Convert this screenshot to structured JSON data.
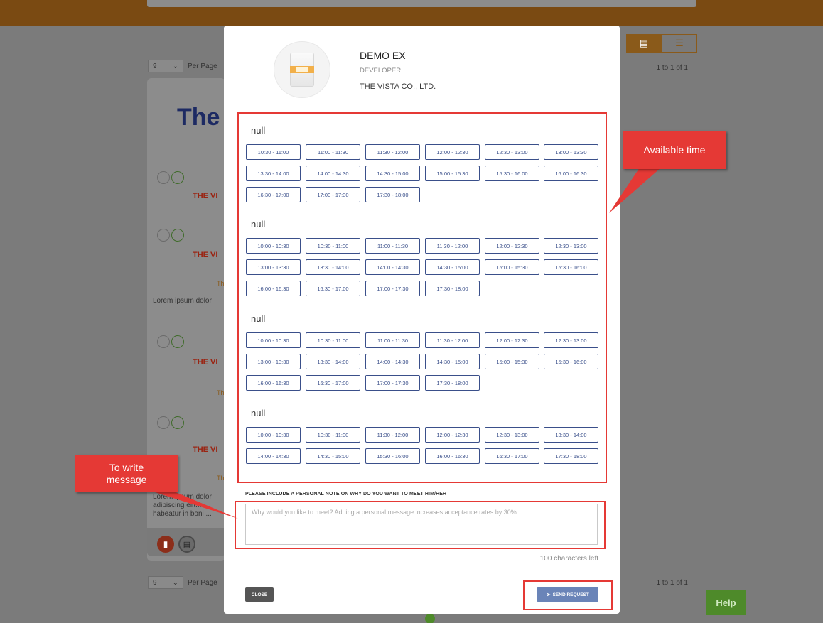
{
  "background": {
    "per_page_value": "9",
    "per_page_label": "Per Page",
    "page_count": "1 to 1 of 1",
    "card_title_fragment": "The",
    "company_fragment": "THE VI",
    "small_fragment": "Th",
    "lorem_1": "Lorem ipsum dolor",
    "lorem_2_lines": [
      "Lorem ipsum dolor",
      "adipiscing elit...",
      "habeatur in boni ..."
    ]
  },
  "help_label": "Help",
  "profile": {
    "name": "DEMO EX",
    "role": "DEVELOPER",
    "company": "THE VISTA CO., LTD."
  },
  "schedule": [
    {
      "title": "null",
      "slots": [
        "10:30 - 11:00",
        "11:00 - 11:30",
        "11:30 - 12:00",
        "12:00 - 12:30",
        "12:30 - 13:00",
        "13:00 - 13:30",
        "13:30 - 14:00",
        "14:00 - 14:30",
        "14:30 - 15:00",
        "15:00 - 15:30",
        "15:30 - 16:00",
        "16:00 - 16:30",
        "16:30 - 17:00",
        "17:00 - 17:30",
        "17:30 - 18:00"
      ]
    },
    {
      "title": "null",
      "slots": [
        "10:00 - 10:30",
        "10:30 - 11:00",
        "11:00 - 11:30",
        "11:30 - 12:00",
        "12:00 - 12:30",
        "12:30 - 13:00",
        "13:00 - 13:30",
        "13:30 - 14:00",
        "14:00 - 14:30",
        "14:30 - 15:00",
        "15:00 - 15:30",
        "15:30 - 16:00",
        "16:00 - 16:30",
        "16:30 - 17:00",
        "17:00 - 17:30",
        "17:30 - 18:00"
      ]
    },
    {
      "title": "null",
      "slots": [
        "10:00 - 10:30",
        "10:30 - 11:00",
        "11:00 - 11:30",
        "11:30 - 12:00",
        "12:00 - 12:30",
        "12:30 - 13:00",
        "13:00 - 13:30",
        "13:30 - 14:00",
        "14:00 - 14:30",
        "14:30 - 15:00",
        "15:00 - 15:30",
        "15:30 - 16:00",
        "16:00 - 16:30",
        "16:30 - 17:00",
        "17:00 - 17:30",
        "17:30 - 18:00"
      ]
    },
    {
      "title": "null",
      "slots": [
        "10:00 - 10:30",
        "10:30 - 11:00",
        "11:30 - 12:00",
        "12:00 - 12:30",
        "12:30 - 13:00",
        "13:30 - 14:00",
        "14:00 - 14:30",
        "14:30 - 15:00",
        "15:30 - 16:00",
        "16:00 - 16:30",
        "16:30 - 17:00",
        "17:30 - 18:00"
      ]
    }
  ],
  "note": {
    "label": "PLEASE INCLUDE A PERSONAL NOTE ON WHY DO YOU WANT TO MEET HIM/HER",
    "placeholder": "Why would you like to meet? Adding a personal message increases acceptance rates by 30%",
    "chars_left": "100 characters left"
  },
  "buttons": {
    "close": "CLOSE",
    "send": "SEND REQUEST"
  },
  "annotations": {
    "available_time": "Available time",
    "write_message": "To write message"
  },
  "colors": {
    "slot_border": "#3a4f8a",
    "annotation_red": "#e53935",
    "send_button": "#6a84b8"
  }
}
